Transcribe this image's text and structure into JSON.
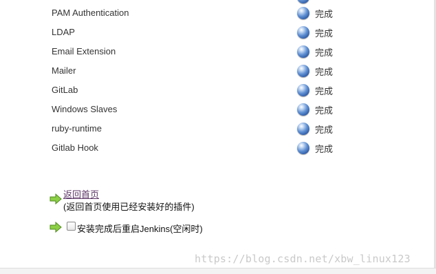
{
  "plugins": [
    {
      "name": "PAM Authentication",
      "status": "完成"
    },
    {
      "name": "LDAP",
      "status": "完成"
    },
    {
      "name": "Email Extension",
      "status": "完成"
    },
    {
      "name": "Mailer",
      "status": "完成"
    },
    {
      "name": "GitLab",
      "status": "完成"
    },
    {
      "name": "Windows Slaves",
      "status": "完成"
    },
    {
      "name": "ruby-runtime",
      "status": "完成"
    },
    {
      "name": "Gitlab Hook",
      "status": "完成"
    }
  ],
  "actions": {
    "home_link": "返回首页",
    "home_desc": "(返回首页使用已经安装好的插件)",
    "restart_label": "安装完成后重启Jenkins(空闲时)",
    "restart_checked": false
  },
  "icons": {
    "status": "blue-ball-icon",
    "action": "green-arrow-icon"
  },
  "colors": {
    "status_ball": "#3f6fbf",
    "arrow": "#7cc23a",
    "link": "#5c3566"
  },
  "watermark": "https://blog.csdn.net/xbw_linux123"
}
